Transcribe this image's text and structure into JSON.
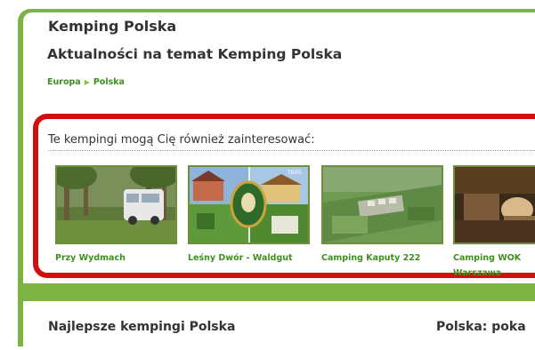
{
  "header": {
    "site_title": "Kemping Polska",
    "page_heading": "Aktualności na temat Kemping Polska"
  },
  "breadcrumb": {
    "items": [
      "Europa",
      "Polska"
    ]
  },
  "recommendations": {
    "title": "Te kempingi mogą Cię również zainteresować:",
    "items": [
      {
        "name": "Przy Wydmach"
      },
      {
        "name": "Leśny Dwór - Waldgut",
        "badge": "TB0S"
      },
      {
        "name": "Camping Kaputy 222"
      },
      {
        "name_line1": "Camping WOK",
        "name_line2": "Warszawa"
      }
    ]
  },
  "bottom": {
    "left_title": "Najlepsze kempingi Polska",
    "right_title": "Polska: poka"
  },
  "colors": {
    "accent_green": "#7cb342",
    "link_green": "#3f8f1e",
    "highlight_red": "#d10f0f"
  }
}
